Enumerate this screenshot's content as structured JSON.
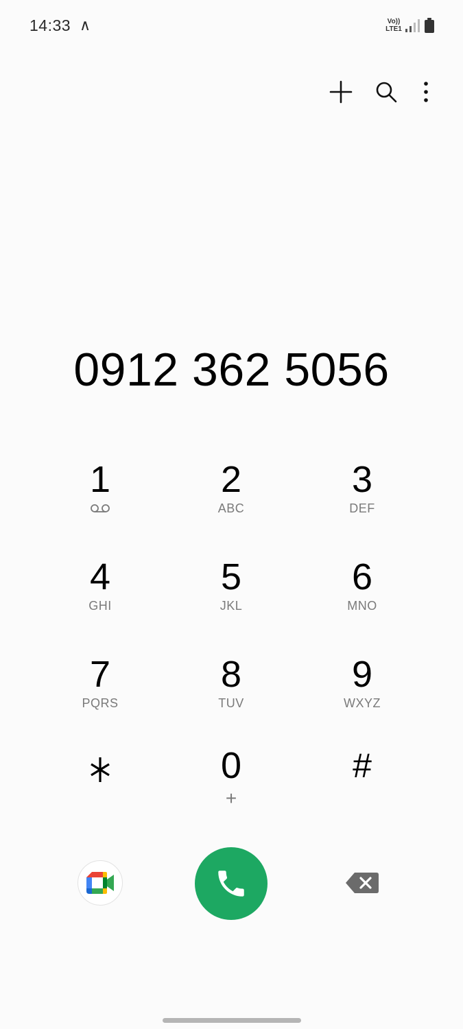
{
  "status_bar": {
    "time": "14:33",
    "notification_glyph": "∧",
    "volte_top": "Vo))",
    "volte_bottom": "LTE1",
    "icons": [
      "volte-icon",
      "signal-icon",
      "battery-icon"
    ]
  },
  "top_actions": [
    "add-icon",
    "search-icon",
    "more-options-icon"
  ],
  "dialed_number": "0912 362 5056",
  "keypad": [
    {
      "digit": "1",
      "letters": "",
      "sub_icon": "voicemail-icon"
    },
    {
      "digit": "2",
      "letters": "ABC"
    },
    {
      "digit": "3",
      "letters": "DEF"
    },
    {
      "digit": "4",
      "letters": "GHI"
    },
    {
      "digit": "5",
      "letters": "JKL"
    },
    {
      "digit": "6",
      "letters": "MNO"
    },
    {
      "digit": "7",
      "letters": "PQRS"
    },
    {
      "digit": "8",
      "letters": "TUV"
    },
    {
      "digit": "9",
      "letters": "WXYZ"
    },
    {
      "digit": "⁎",
      "letters": ""
    },
    {
      "digit": "0",
      "letters": "+"
    },
    {
      "digit": "#",
      "letters": ""
    }
  ],
  "bottom_actions": {
    "video_call_icon": "google-meet-icon",
    "call_icon": "phone-icon",
    "delete_icon": "backspace-icon"
  },
  "colors": {
    "call_button": "#1da862",
    "background": "#fbfbfb",
    "secondary_text": "#7a7a7a"
  }
}
